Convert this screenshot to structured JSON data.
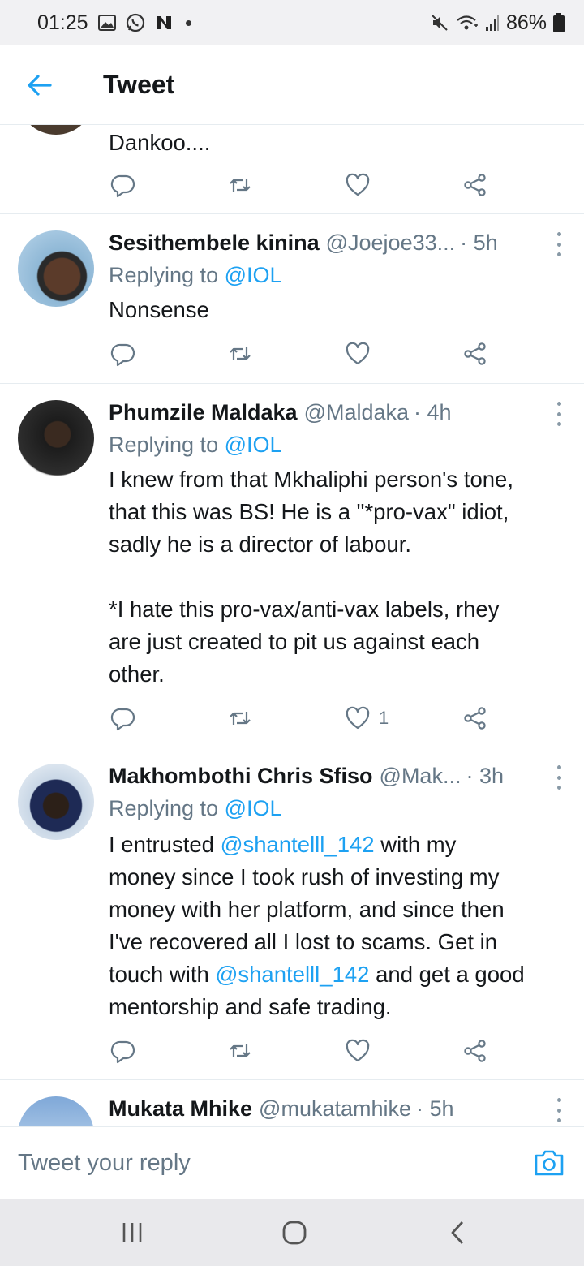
{
  "status_bar": {
    "time": "01:25",
    "battery": "86%",
    "left_icons": [
      "gallery-icon",
      "whatsapp-icon",
      "n-icon"
    ],
    "right_icons": [
      "mute-icon",
      "wifi-icon",
      "signal-icon",
      "battery-icon"
    ]
  },
  "header": {
    "title": "Tweet"
  },
  "partial_tweet": {
    "text": "Dankoo...."
  },
  "tweets": [
    {
      "name": "Sesithembele kinina",
      "handle": "@Joejoe33...",
      "time": "· 5h",
      "replying_prefix": "Replying to ",
      "replying_to": "@IOL",
      "body": "Nonsense",
      "likes": ""
    },
    {
      "name": "Phumzile Maldaka",
      "handle": "@Maldaka",
      "time": "· 4h",
      "replying_prefix": "Replying to ",
      "replying_to": "@IOL",
      "body_lines": [
        "I knew from that Mkhaliphi person's tone,",
        "that this was BS! He is a \"*pro-vax\" idiot,",
        "sadly he is a director of labour.",
        "",
        "*I hate this pro-vax/anti-vax labels, rhey",
        "are just created to pit us against each",
        "other."
      ],
      "likes": "1"
    },
    {
      "name": "Makhombothi Chris Sfiso",
      "handle": "@Mak...",
      "time": "· 3h",
      "replying_prefix": "Replying to ",
      "replying_to": "@IOL",
      "body_parts": {
        "p1": "I entrusted ",
        "mention1": "@shantelll_142",
        "p2": " with my",
        "line2": "money since I took rush of investing my",
        "line3": "money with her platform, and since then",
        "line4": "I've recovered all I lost to scams. Get in",
        "p5a": "touch with ",
        "mention2": "@shantelll_142",
        "p5b": " and get a good",
        "line6": "mentorship and safe trading."
      },
      "likes": ""
    },
    {
      "name": "Mukata Mhike",
      "handle": "@mukatamhike",
      "time": "· 5h"
    }
  ],
  "composer": {
    "placeholder": "Tweet your reply"
  },
  "colors": {
    "accent": "#1da1f2",
    "text": "#14171a",
    "secondary": "#657786"
  }
}
